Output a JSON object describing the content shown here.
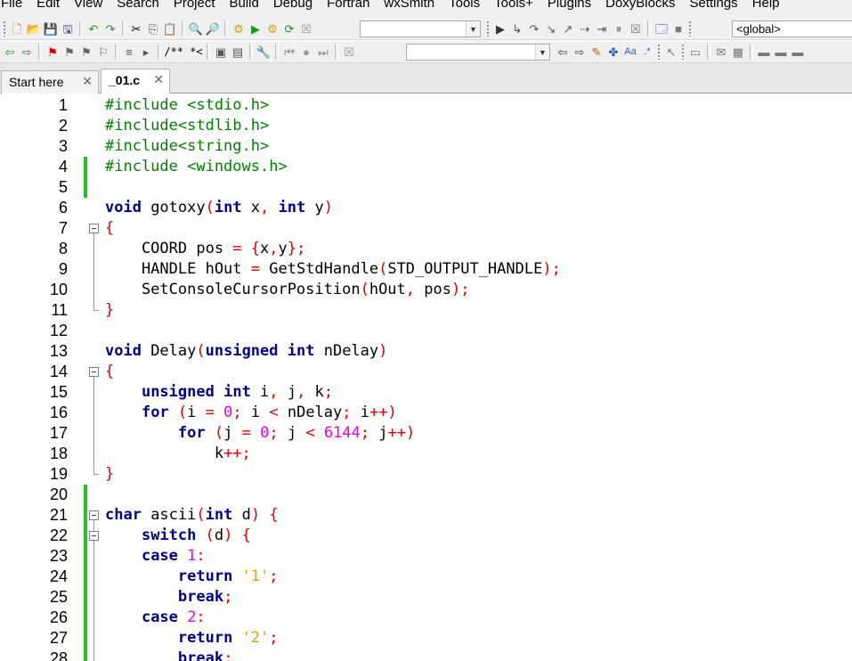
{
  "menu": [
    "File",
    "Edit",
    "View",
    "Search",
    "Project",
    "Build",
    "Debug",
    "Fortran",
    "wxSmith",
    "Tools",
    "Tools+",
    "Plugins",
    "DoxyBlocks",
    "Settings",
    "Help"
  ],
  "toolbar": {
    "scope_combo_value": "<global>",
    "build_target_value": "",
    "search_combo_value": "",
    "comment_label": "/** *<"
  },
  "tabs": [
    {
      "label": "Start here",
      "active": false
    },
    {
      "label": "_01.c",
      "active": true
    }
  ],
  "editor": {
    "lines": [
      {
        "n": "1",
        "t": [
          [
            "pp",
            "#include <stdio.h>"
          ]
        ]
      },
      {
        "n": "2",
        "t": [
          [
            "pp",
            "#include<stdlib.h>"
          ]
        ]
      },
      {
        "n": "3",
        "t": [
          [
            "pp",
            "#include<string.h>"
          ]
        ]
      },
      {
        "n": "4",
        "t": [
          [
            "pp",
            "#include <windows.h>"
          ]
        ]
      },
      {
        "n": "5",
        "t": []
      },
      {
        "n": "6",
        "t": [
          [
            "kw",
            "void"
          ],
          [
            "id",
            " gotoxy"
          ],
          [
            "op",
            "("
          ],
          [
            "kw",
            "int"
          ],
          [
            "id",
            " x"
          ],
          [
            "op",
            ","
          ],
          [
            "id",
            " "
          ],
          [
            "kw",
            "int"
          ],
          [
            "id",
            " y"
          ],
          [
            "op",
            ")"
          ]
        ]
      },
      {
        "n": "7",
        "t": [
          [
            "op",
            "{"
          ]
        ]
      },
      {
        "n": "8",
        "t": [
          [
            "id",
            "    COORD pos "
          ],
          [
            "op",
            "="
          ],
          [
            "id",
            " "
          ],
          [
            "op",
            "{"
          ],
          [
            "id",
            "x"
          ],
          [
            "op",
            ","
          ],
          [
            "id",
            "y"
          ],
          [
            "op",
            "};"
          ]
        ]
      },
      {
        "n": "9",
        "t": [
          [
            "id",
            "    HANDLE hOut "
          ],
          [
            "op",
            "="
          ],
          [
            "id",
            " GetStdHandle"
          ],
          [
            "op",
            "("
          ],
          [
            "id",
            "STD_OUTPUT_HANDLE"
          ],
          [
            "op",
            ");"
          ]
        ]
      },
      {
        "n": "10",
        "t": [
          [
            "id",
            "    SetConsoleCursorPosition"
          ],
          [
            "op",
            "("
          ],
          [
            "id",
            "hOut"
          ],
          [
            "op",
            ","
          ],
          [
            "id",
            " pos"
          ],
          [
            "op",
            ");"
          ]
        ]
      },
      {
        "n": "11",
        "t": [
          [
            "op",
            "}"
          ]
        ]
      },
      {
        "n": "12",
        "t": []
      },
      {
        "n": "13",
        "t": [
          [
            "kw",
            "void"
          ],
          [
            "id",
            " Delay"
          ],
          [
            "op",
            "("
          ],
          [
            "kw",
            "unsigned"
          ],
          [
            "id",
            " "
          ],
          [
            "kw",
            "int"
          ],
          [
            "id",
            " nDelay"
          ],
          [
            "op",
            ")"
          ]
        ]
      },
      {
        "n": "14",
        "t": [
          [
            "op",
            "{"
          ]
        ]
      },
      {
        "n": "15",
        "t": [
          [
            "id",
            "    "
          ],
          [
            "kw",
            "unsigned"
          ],
          [
            "id",
            " "
          ],
          [
            "kw",
            "int"
          ],
          [
            "id",
            " i"
          ],
          [
            "op",
            ","
          ],
          [
            "id",
            " j"
          ],
          [
            "op",
            ","
          ],
          [
            "id",
            " k"
          ],
          [
            "op",
            ";"
          ]
        ]
      },
      {
        "n": "16",
        "t": [
          [
            "id",
            "    "
          ],
          [
            "kw",
            "for"
          ],
          [
            "id",
            " "
          ],
          [
            "op",
            "("
          ],
          [
            "id",
            "i "
          ],
          [
            "op",
            "="
          ],
          [
            "id",
            " "
          ],
          [
            "num",
            "0"
          ],
          [
            "op",
            ";"
          ],
          [
            "id",
            " i "
          ],
          [
            "op",
            "<"
          ],
          [
            "id",
            " nDelay"
          ],
          [
            "op",
            ";"
          ],
          [
            "id",
            " i"
          ],
          [
            "op",
            "++)"
          ]
        ]
      },
      {
        "n": "17",
        "t": [
          [
            "id",
            "        "
          ],
          [
            "kw",
            "for"
          ],
          [
            "id",
            " "
          ],
          [
            "op",
            "("
          ],
          [
            "id",
            "j "
          ],
          [
            "op",
            "="
          ],
          [
            "id",
            " "
          ],
          [
            "num",
            "0"
          ],
          [
            "op",
            ";"
          ],
          [
            "id",
            " j "
          ],
          [
            "op",
            "<"
          ],
          [
            "id",
            " "
          ],
          [
            "num",
            "6144"
          ],
          [
            "op",
            ";"
          ],
          [
            "id",
            " j"
          ],
          [
            "op",
            "++)"
          ]
        ]
      },
      {
        "n": "18",
        "t": [
          [
            "id",
            "            k"
          ],
          [
            "op",
            "++;"
          ]
        ]
      },
      {
        "n": "19",
        "t": [
          [
            "op",
            "}"
          ]
        ]
      },
      {
        "n": "20",
        "t": []
      },
      {
        "n": "21",
        "t": [
          [
            "kw",
            "char"
          ],
          [
            "id",
            " ascii"
          ],
          [
            "op",
            "("
          ],
          [
            "kw",
            "int"
          ],
          [
            "id",
            " d"
          ],
          [
            "op",
            ")"
          ],
          [
            "id",
            " "
          ],
          [
            "op",
            "{"
          ]
        ]
      },
      {
        "n": "22",
        "t": [
          [
            "id",
            "    "
          ],
          [
            "kw",
            "switch"
          ],
          [
            "id",
            " "
          ],
          [
            "op",
            "("
          ],
          [
            "id",
            "d"
          ],
          [
            "op",
            ")"
          ],
          [
            "id",
            " "
          ],
          [
            "op",
            "{"
          ]
        ]
      },
      {
        "n": "23",
        "t": [
          [
            "id",
            "    "
          ],
          [
            "kw",
            "case"
          ],
          [
            "id",
            " "
          ],
          [
            "num",
            "1"
          ],
          [
            "op",
            ":"
          ]
        ]
      },
      {
        "n": "24",
        "t": [
          [
            "id",
            "        "
          ],
          [
            "kw",
            "return"
          ],
          [
            "id",
            " "
          ],
          [
            "chr",
            "'1'"
          ],
          [
            "op",
            ";"
          ]
        ]
      },
      {
        "n": "25",
        "t": [
          [
            "id",
            "        "
          ],
          [
            "kw",
            "break"
          ],
          [
            "op",
            ";"
          ]
        ]
      },
      {
        "n": "26",
        "t": [
          [
            "id",
            "    "
          ],
          [
            "kw",
            "case"
          ],
          [
            "id",
            " "
          ],
          [
            "num",
            "2"
          ],
          [
            "op",
            ":"
          ]
        ]
      },
      {
        "n": "27",
        "t": [
          [
            "id",
            "        "
          ],
          [
            "kw",
            "return"
          ],
          [
            "id",
            " "
          ],
          [
            "chr",
            "'2'"
          ],
          [
            "op",
            ";"
          ]
        ]
      },
      {
        "n": "28",
        "t": [
          [
            "id",
            "        "
          ],
          [
            "kw",
            "break"
          ],
          [
            "op",
            ";"
          ]
        ]
      }
    ]
  },
  "colors": {
    "preprocessor": "#008000",
    "keyword": "#00008b",
    "operator": "#e00000",
    "number": "#e800e8",
    "char_literal": "#e0a000",
    "change_bar": "#22c422"
  }
}
